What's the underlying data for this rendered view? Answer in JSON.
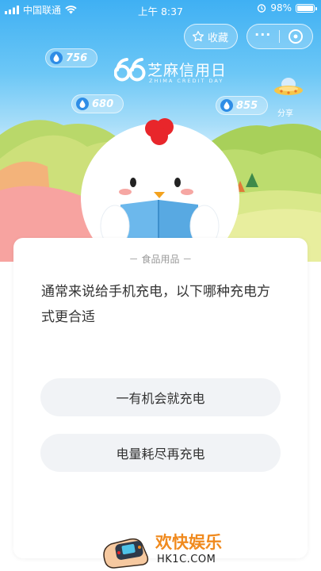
{
  "status_bar": {
    "carrier": "中国联通",
    "time": "上午 8:37",
    "battery": "98%",
    "battery_level": 0.98
  },
  "top_actions": {
    "favorite_label": "收藏",
    "more_label": "···"
  },
  "energy_bubbles": [
    {
      "value": "756"
    },
    {
      "value": "680"
    },
    {
      "value": "855"
    }
  ],
  "logo": {
    "title": "芝麻信用日",
    "subtitle": "ZHIMA CREDIT DAY"
  },
  "share_label": "分享",
  "quiz": {
    "category": "－ 食品用品 －",
    "question": "通常来说给手机充电，以下哪种充电方式更合适",
    "options": [
      {
        "label": "一有机会就充电"
      },
      {
        "label": "电量耗尽再充电"
      }
    ]
  },
  "watermark": {
    "title": "欢快娱乐",
    "domain": "HK1C.COM"
  },
  "colors": {
    "sky_top": "#3fb0f3",
    "option_bg": "#f1f3f6",
    "watermark_orange": "#f08a1e"
  }
}
